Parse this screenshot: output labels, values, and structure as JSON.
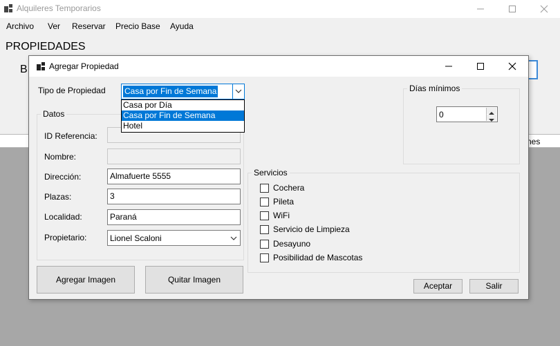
{
  "main_window": {
    "title": "Alquileres Temporarios",
    "menu": [
      "Archivo",
      "Ver",
      "Reservar",
      "Precio Base",
      "Ayuda"
    ],
    "heading": "PROPIEDADES",
    "partial_label": "B",
    "grid_header_partial": "nes"
  },
  "dialog": {
    "title": "Agregar Propiedad",
    "tipo_label": "Tipo de Propiedad",
    "tipo_selected": "Casa por Fin de Semana",
    "tipo_options": [
      "Casa por Día",
      "Casa por Fin de Semana",
      "Hotel"
    ],
    "tipo_highlighted_index": 1,
    "datos_group": "Datos",
    "fields": {
      "id_label": "ID Referencia:",
      "id_value": "",
      "nombre_label": "Nombre:",
      "nombre_value": "",
      "direccion_label": "Dirección:",
      "direccion_value": "Almafuerte 5555",
      "plazas_label": "Plazas:",
      "plazas_value": "3",
      "localidad_label": "Localidad:",
      "localidad_value": "Paraná",
      "propietario_label": "Propietario:",
      "propietario_value": "Lionel Scaloni"
    },
    "dias_group": "Días mínimos",
    "dias_value": "0",
    "servicios_group": "Servicios",
    "servicios": [
      {
        "label": "Cochera",
        "checked": false
      },
      {
        "label": "Pileta",
        "checked": false
      },
      {
        "label": "WiFi",
        "checked": false
      },
      {
        "label": "Servicio de Limpieza",
        "checked": false
      },
      {
        "label": "Desayuno",
        "checked": false
      },
      {
        "label": "Posibilidad de Mascotas",
        "checked": false
      }
    ],
    "buttons": {
      "agregar_imagen": "Agregar Imagen",
      "quitar_imagen": "Quitar Imagen",
      "aceptar": "Aceptar",
      "salir": "Salir"
    }
  },
  "colors": {
    "selection": "#0078d7",
    "background": "#f0f0f0",
    "gray_area": "#a7a7a7"
  }
}
